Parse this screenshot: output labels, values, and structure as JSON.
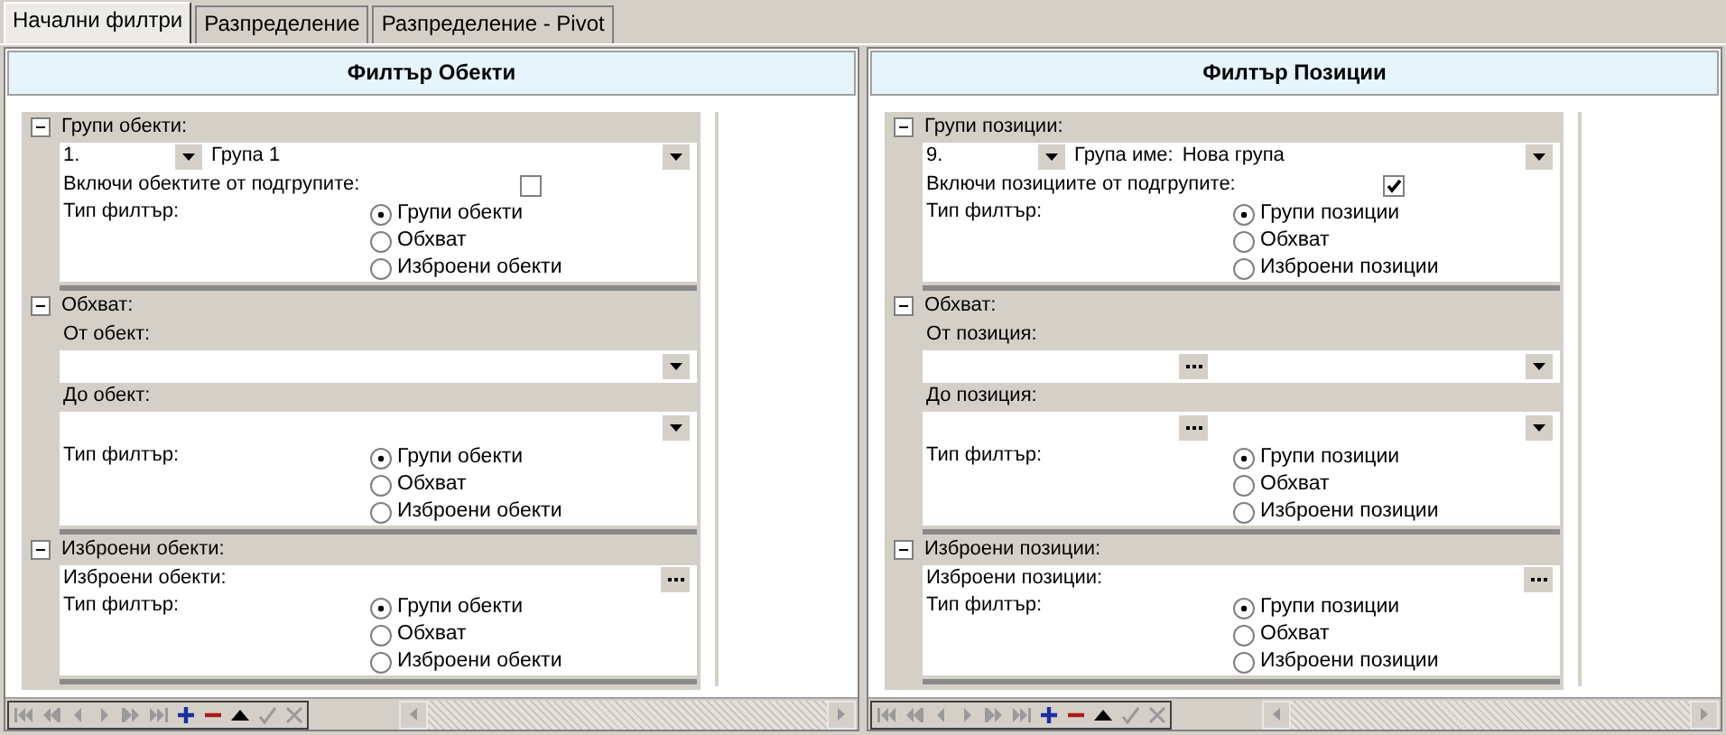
{
  "tabs": [
    {
      "label": "Начални филтри",
      "selected": true
    },
    {
      "label": "Разпределение",
      "selected": false
    },
    {
      "label": "Разпределение - Pivot",
      "selected": false
    }
  ],
  "panels": [
    {
      "title": "Филтър Обекти",
      "sections": [
        {
          "title": "Групи обекти:",
          "expanded": true,
          "rows": [
            {
              "kind": "group_select",
              "number": "1.",
              "name": "Група 1"
            },
            {
              "kind": "checkbox",
              "label": "Включи обектите от подгрупите:",
              "checked": false
            },
            {
              "kind": "radios",
              "label": "Тип филтър:",
              "options": [
                {
                  "label": "Групи обекти",
                  "selected": true
                },
                {
                  "label": "Обхват",
                  "selected": false
                },
                {
                  "label": "Изброени обекти",
                  "selected": false
                }
              ]
            }
          ]
        },
        {
          "title": "Обхват:",
          "expanded": true,
          "rows": [
            {
              "kind": "label",
              "label": "От обект:"
            },
            {
              "kind": "lookup",
              "ellipsis": false
            },
            {
              "kind": "label",
              "label": "До обект:"
            },
            {
              "kind": "lookup",
              "ellipsis": false
            },
            {
              "kind": "radios",
              "label": "Тип филтър:",
              "options": [
                {
                  "label": "Групи обекти",
                  "selected": true
                },
                {
                  "label": "Обхват",
                  "selected": false
                },
                {
                  "label": "Изброени обекти",
                  "selected": false
                }
              ]
            }
          ]
        },
        {
          "title": "Изброени обекти:",
          "expanded": true,
          "rows": [
            {
              "kind": "picker",
              "label": "Изброени обекти:"
            },
            {
              "kind": "radios",
              "label": "Тип филтър:",
              "options": [
                {
                  "label": "Групи обекти",
                  "selected": true
                },
                {
                  "label": "Обхват",
                  "selected": false
                },
                {
                  "label": "Изброени обекти",
                  "selected": false
                }
              ]
            }
          ]
        }
      ]
    },
    {
      "title": "Филтър Позиции",
      "sections": [
        {
          "title": "Групи позиции:",
          "expanded": true,
          "rows": [
            {
              "kind": "group_select",
              "number": "9.",
              "name_label": "Група име:",
              "name": "Нова група"
            },
            {
              "kind": "checkbox",
              "label": "Включи позициите от подгрупите:",
              "checked": true
            },
            {
              "kind": "radios",
              "label": "Тип филтър:",
              "options": [
                {
                  "label": "Групи позиции",
                  "selected": true
                },
                {
                  "label": "Обхват",
                  "selected": false
                },
                {
                  "label": "Изброени позиции",
                  "selected": false
                }
              ]
            }
          ]
        },
        {
          "title": "Обхват:",
          "expanded": true,
          "rows": [
            {
              "kind": "label",
              "label": "От позиция:"
            },
            {
              "kind": "lookup",
              "ellipsis": true
            },
            {
              "kind": "label",
              "label": "До позиция:"
            },
            {
              "kind": "lookup",
              "ellipsis": true
            },
            {
              "kind": "radios",
              "label": "Тип филтър:",
              "options": [
                {
                  "label": "Групи позиции",
                  "selected": true
                },
                {
                  "label": "Обхват",
                  "selected": false
                },
                {
                  "label": "Изброени позиции",
                  "selected": false
                }
              ]
            }
          ]
        },
        {
          "title": "Изброени позиции:",
          "expanded": true,
          "rows": [
            {
              "kind": "picker",
              "label": "Изброени позиции:"
            },
            {
              "kind": "radios",
              "label": "Тип филтър:",
              "options": [
                {
                  "label": "Групи позиции",
                  "selected": true
                },
                {
                  "label": "Обхват",
                  "selected": false
                },
                {
                  "label": "Изброени позиции",
                  "selected": false
                }
              ]
            }
          ]
        }
      ]
    }
  ]
}
